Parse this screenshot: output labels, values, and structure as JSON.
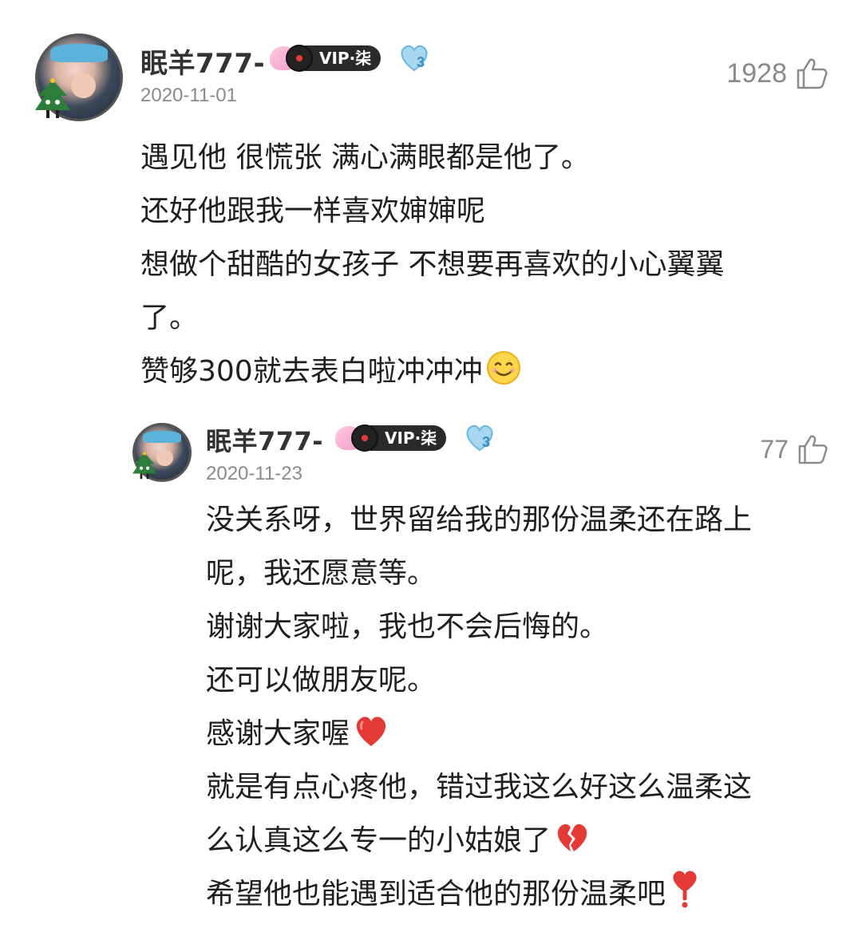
{
  "comments": [
    {
      "username": "眠羊777-",
      "vip_label": "VIP·柒",
      "level": "3",
      "date": "2020-11-01",
      "likes": "1928",
      "lines": [
        "遇见他 很慌张 满心满眼都是他了。",
        "还好他跟我一样喜欢婶婶呢",
        "想做个甜酷的女孩子 不想要再喜欢的小心翼翼",
        "了。",
        "赞够300就去表白啦冲冲冲"
      ],
      "emoji": "smile-emoji"
    },
    {
      "username": "眠羊777-",
      "vip_label": "VIP·柒",
      "level": "3",
      "date": "2020-11-23",
      "likes": "77",
      "lines": [
        "没关系呀，世界留给我的那份温柔还在路上",
        "呢，我还愿意等。",
        "谢谢大家啦，我也不会后悔的。",
        "还可以做朋友呢。",
        "感谢大家喔",
        "就是有点心疼他，错过我这么好这么温柔这",
        "么认真这么专一的小姑娘了",
        "希望他也能遇到适合他的那份温柔吧"
      ],
      "emojis": [
        "red-heart-emoji",
        "broken-heart-emoji",
        "heart-exclamation-emoji"
      ]
    }
  ]
}
